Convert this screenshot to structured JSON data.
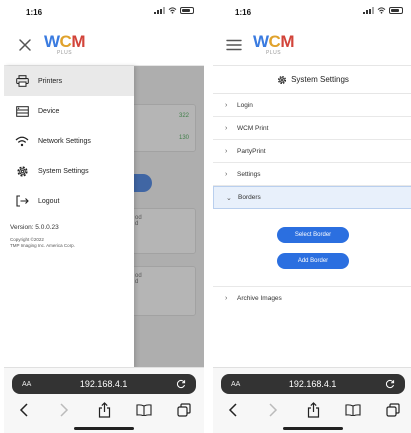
{
  "left_screen": {
    "status": {
      "time": "1:16"
    },
    "menu": {
      "items": [
        {
          "label": "Printers",
          "icon": "printer-icon"
        },
        {
          "label": "Device",
          "icon": "device-icon"
        },
        {
          "label": "Network Settings",
          "icon": "wifi-icon"
        },
        {
          "label": "System Settings",
          "icon": "gear-icon"
        },
        {
          "label": "Logout",
          "icon": "logout-icon"
        }
      ],
      "version": "Version: 5.0.0.23",
      "copyright_line1": "Copyright ©2022",
      "copyright_line2": "TMP Imaging Inc. America Corp."
    },
    "background": {
      "count_1": "322",
      "count_2": "130",
      "card1_text": "od d",
      "card2_text": "od d"
    },
    "browser": {
      "aa_label": "AA",
      "url": "192.168.4.1"
    }
  },
  "right_screen": {
    "status": {
      "time": "1:16"
    },
    "page_title": "System Settings",
    "sections": [
      {
        "label": "Login"
      },
      {
        "label": "WCM Print"
      },
      {
        "label": "PartyPrint"
      },
      {
        "label": "Settings"
      }
    ],
    "open_section": {
      "label": "Borders",
      "buttons": {
        "select": "Select Border",
        "add": "Add Border"
      }
    },
    "after_sections": [
      {
        "label": "Archive Images"
      }
    ],
    "browser": {
      "aa_label": "AA",
      "url": "192.168.4.1"
    }
  },
  "logo": {
    "w": "W",
    "c": "C",
    "m": "M",
    "sub": "PLUS"
  },
  "colors": {
    "accent": "#2b6fe0",
    "active_bg": "#e8f0fb",
    "count_green": "#2a9b3a"
  }
}
